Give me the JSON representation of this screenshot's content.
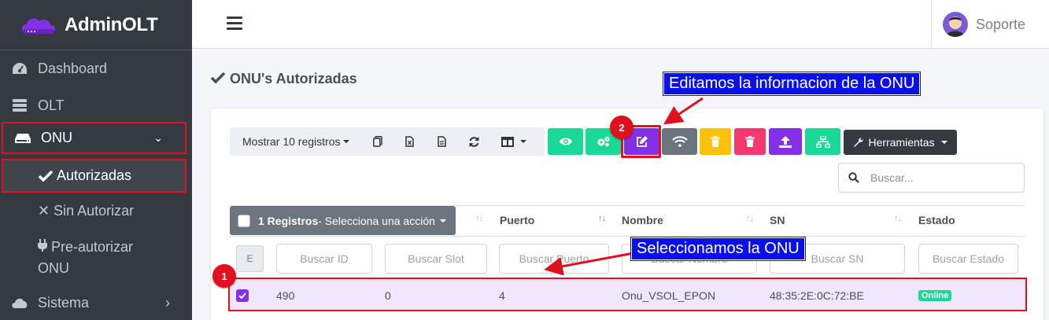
{
  "brand": {
    "name": "AdminOLT"
  },
  "sidebar": {
    "items": [
      {
        "label": "Dashboard"
      },
      {
        "label": "OLT"
      },
      {
        "label": "ONU"
      },
      {
        "label": "Autorizadas"
      },
      {
        "label": "Sin Autorizar"
      },
      {
        "label": "Pre-autorizar"
      },
      {
        "label": "ONU"
      },
      {
        "label": "Sistema"
      }
    ]
  },
  "header": {
    "user": "Soporte"
  },
  "page": {
    "title": "ONU's Autorizadas"
  },
  "toolbar": {
    "length_label": "Mostrar 10 registros",
    "tools_label": "Herramientas"
  },
  "search": {
    "placeholder": "Buscar..."
  },
  "table": {
    "bulk_count": "1 Registros",
    "bulk_action": " - Selecciona una acción",
    "columns": [
      "Puerto",
      "Nombre",
      "SN",
      "Estado"
    ],
    "filter_placeholders": [
      "Buscar ID",
      "Buscar Slot",
      "Buscar Puerto",
      "Buscar Nombre",
      "Buscar SN",
      "Buscar Estado"
    ],
    "small_button": "E",
    "rows": [
      {
        "id": "490",
        "slot": "0",
        "port": "4",
        "name": "Onu_VSOL_EPON",
        "sn": "48:35:2E:0C:72:BE",
        "status": "Online"
      }
    ]
  },
  "annotations": {
    "edit_callout": "Editamos la informacion de la ONU",
    "select_callout": "Seleccionamos la ONU",
    "step1": "1",
    "step2": "2"
  },
  "colors": {
    "sidebar": "#343a40",
    "accent_purple": "#8330e6",
    "accent_green": "#1ad896",
    "highlight_red": "#e0101f",
    "callout_blue": "#0a10e6"
  }
}
